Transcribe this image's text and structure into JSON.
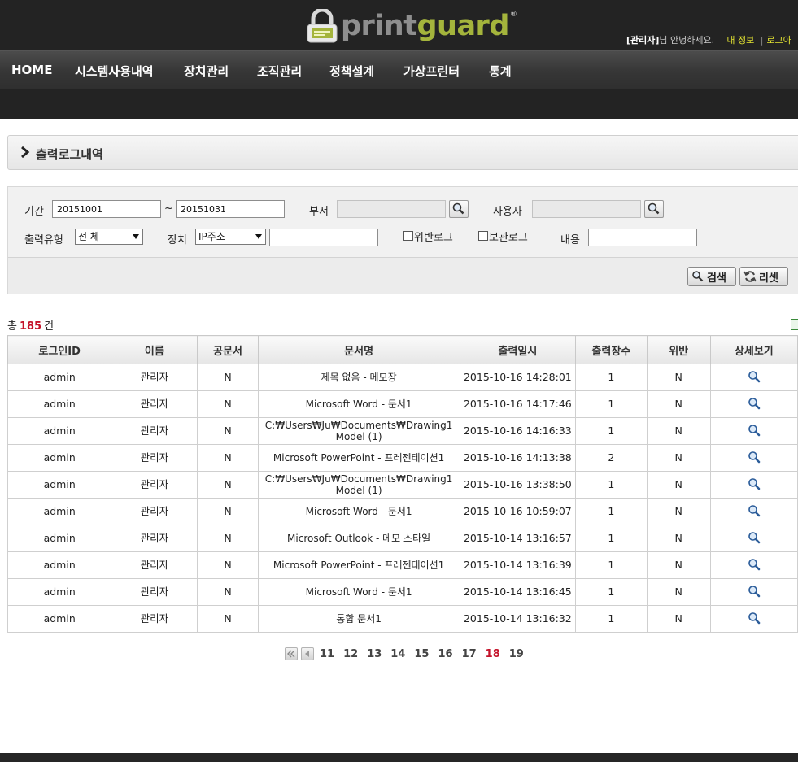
{
  "header": {
    "logo_print": "print",
    "logo_guard": "guard",
    "logo_reg": "®",
    "user_role": "[관리자]",
    "greeting": "님 안녕하세요.",
    "my_info": "내 정보",
    "logout": "로그아"
  },
  "nav": {
    "items": [
      "HOME",
      "시스템사용내역",
      "장치관리",
      "조직관리",
      "정책설계",
      "가상프린터",
      "통계"
    ]
  },
  "page": {
    "title": "출력로그내역"
  },
  "search": {
    "period_label": "기간",
    "date_from": "20151001",
    "date_sep": "~",
    "date_to": "20151031",
    "dept_label": "부서",
    "dept_value": "",
    "user_label": "사용자",
    "user_value": "",
    "output_type_label": "출력유형",
    "output_type_value": "전 체",
    "device_label": "장치",
    "device_value": "IP주소",
    "device_text": "",
    "violation_label": "위반로그",
    "violation_checked": false,
    "keep_label": "보관로그",
    "keep_checked": false,
    "content_label": "내용",
    "content_value": "",
    "search_button": "검색",
    "reset_button": "리셋"
  },
  "summary": {
    "prefix": "총",
    "count": "185",
    "suffix": "건"
  },
  "table": {
    "headers": [
      "로그인ID",
      "이름",
      "공문서",
      "문서명",
      "출력일시",
      "출력장수",
      "위반",
      "상세보기"
    ],
    "rows": [
      [
        "admin",
        "관리자",
        "N",
        "제목 없음 - 메모장",
        "2015-10-16 14:28:01",
        "1",
        "N"
      ],
      [
        "admin",
        "관리자",
        "N",
        "Microsoft Word - 문서1",
        "2015-10-16 14:17:46",
        "1",
        "N"
      ],
      [
        "admin",
        "관리자",
        "N",
        "C:₩Users₩Ju₩Documents₩Drawing1 Model (1)",
        "2015-10-16 14:16:33",
        "1",
        "N"
      ],
      [
        "admin",
        "관리자",
        "N",
        "Microsoft PowerPoint - 프레젠테이션1",
        "2015-10-16 14:13:38",
        "2",
        "N"
      ],
      [
        "admin",
        "관리자",
        "N",
        "C:₩Users₩Ju₩Documents₩Drawing1 Model (1)",
        "2015-10-16 13:38:50",
        "1",
        "N"
      ],
      [
        "admin",
        "관리자",
        "N",
        "Microsoft Word - 문서1",
        "2015-10-16 10:59:07",
        "1",
        "N"
      ],
      [
        "admin",
        "관리자",
        "N",
        "Microsoft Outlook - 메모 스타일",
        "2015-10-14 13:16:57",
        "1",
        "N"
      ],
      [
        "admin",
        "관리자",
        "N",
        "Microsoft PowerPoint - 프레젠테이션1",
        "2015-10-14 13:16:39",
        "1",
        "N"
      ],
      [
        "admin",
        "관리자",
        "N",
        "Microsoft Word - 문서1",
        "2015-10-14 13:16:45",
        "1",
        "N"
      ],
      [
        "admin",
        "관리자",
        "N",
        "통합 문서1",
        "2015-10-14 13:16:32",
        "1",
        "N"
      ]
    ],
    "detail_icon": "magnifier-icon"
  },
  "pagination": {
    "pages": [
      "11",
      "12",
      "13",
      "14",
      "15",
      "16",
      "17",
      "18",
      "19"
    ],
    "current": "18"
  },
  "colors": {
    "header_bg": "#232323",
    "accent_green": "#a4b43c",
    "highlight_red": "#c4132a",
    "link_yellow": "#e3e332"
  }
}
